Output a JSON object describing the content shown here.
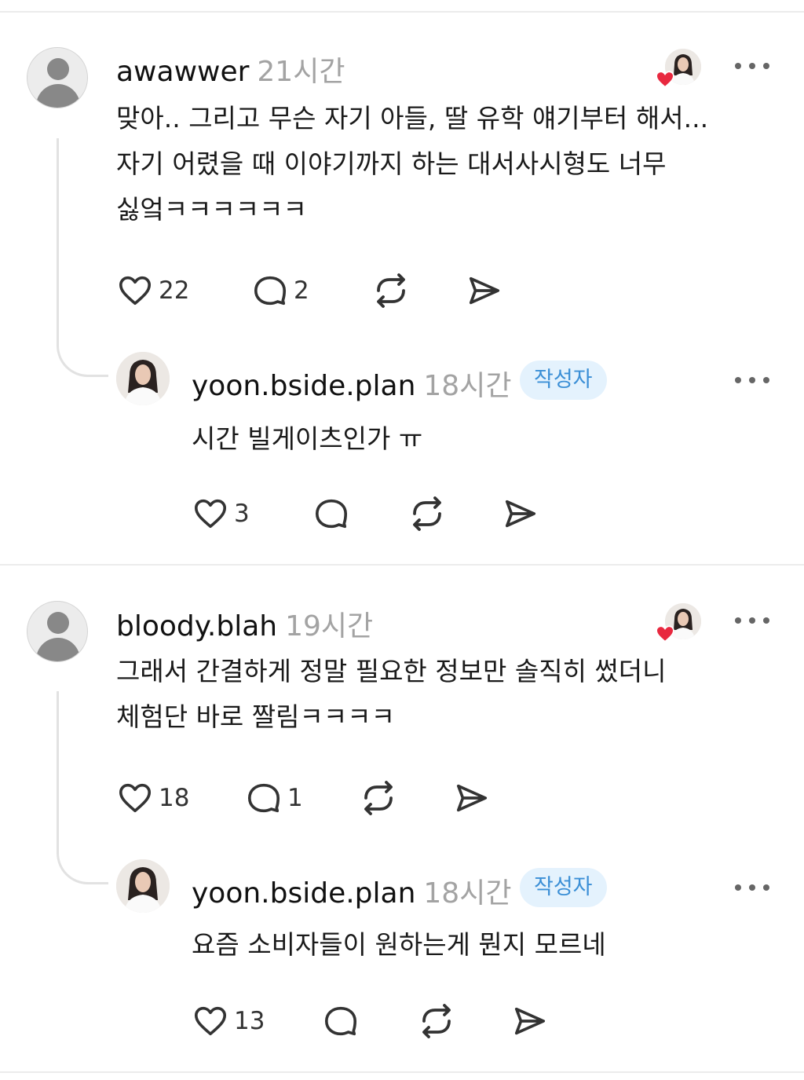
{
  "comments": [
    {
      "username": "awawwer",
      "time": "21시간",
      "text_lines": [
        "맞아.. 그리고 무슨 자기 아들, 딸 유학 얘기부터 해서...",
        "자기 어렸을 때 이야기까지 하는 대서사시형도 너무",
        "싫엌ㅋㅋㅋㅋㅋㅋ"
      ],
      "likes": "22",
      "replies": "2",
      "reply": {
        "username": "yoon.bside.plan",
        "time": "18시간",
        "badge": "작성자",
        "text": "시간 빌게이츠인가 ㅠ",
        "likes": "3"
      }
    },
    {
      "username": "bloody.blah",
      "time": "19시간",
      "text_lines": [
        "그래서 간결하게 정말 필요한 정보만 솔직히 썼더니",
        "체험단 바로 짤림ㅋㅋㅋㅋ"
      ],
      "likes": "18",
      "replies": "1",
      "reply": {
        "username": "yoon.bside.plan",
        "time": "18시간",
        "badge": "작성자",
        "text": "요즘 소비자들이 원하는게 뭔지 모르네",
        "likes": "13"
      }
    }
  ],
  "icons": {
    "like": "heart-outline-icon",
    "reply": "speech-bubble-icon",
    "repost": "repost-icon",
    "share": "send-icon",
    "more": "more-dots-icon",
    "liked_by_author": "heart-filled-icon"
  },
  "colors": {
    "accent_badge_bg": "#e4f2fd",
    "accent_badge_text": "#3b8fd6",
    "heart": "#e8283f",
    "muted": "#a3a3a3"
  }
}
